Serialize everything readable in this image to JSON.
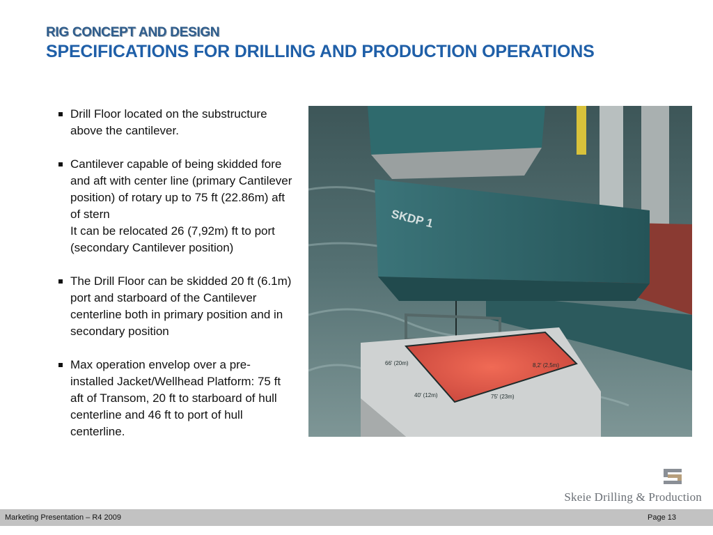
{
  "header": {
    "kicker": "RIG CONCEPT AND DESIGN",
    "title": "SPECIFICATIONS FOR DRILLING AND PRODUCTION OPERATIONS"
  },
  "bullets": [
    {
      "text": "Drill Floor located on the substructure above the cantilever."
    },
    {
      "text": "Cantilever capable of being skidded fore and aft with center line (primary Cantilever position) of rotary up to 75 ft (22.86m) aft of stern",
      "continuation": "It can be relocated 26 (7,92m) ft to port (secondary Cantilever position)"
    },
    {
      "text": "The Drill Floor can be skidded 20 ft (6.1m) port and starboard of the Cantilever centerline both in primary position and in secondary position"
    },
    {
      "text": "Max operation envelop over a pre-installed Jacket/Wellhead Platform: 75 ft aft of Transom, 20 ft to starboard of hull centerline and 46 ft to port of hull centerline."
    }
  ],
  "image": {
    "hull_marking": "SKDP 1",
    "dimensions": {
      "d66": "66' (20m)",
      "d82": "8,2' (2,5m)",
      "d40": "40' (12m)",
      "d75": "75' (23m)"
    },
    "colors": {
      "sea": "#4a6466",
      "hull": "#2f6468",
      "deck": "#8a3a32",
      "platform": "#cfd2d2",
      "envelope": "#d9534a"
    }
  },
  "logo": {
    "icon": "skeie-logo-mark",
    "text": "Skeie Drilling & Production",
    "colors": {
      "grey": "#8a8f96",
      "tan": "#b79f7c"
    }
  },
  "footer": {
    "left": "Marketing Presentation – R4 2009",
    "right": "Page 13",
    "background": "#c2c2c2"
  }
}
